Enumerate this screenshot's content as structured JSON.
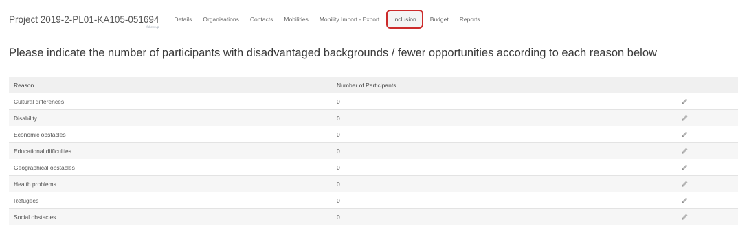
{
  "project": {
    "title": "Project 2019-2-PL01-KA105-051694",
    "subtitle": "follow-up"
  },
  "nav": {
    "tabs": [
      {
        "label": "Details",
        "active": false
      },
      {
        "label": "Organisations",
        "active": false
      },
      {
        "label": "Contacts",
        "active": false
      },
      {
        "label": "Mobilities",
        "active": false
      },
      {
        "label": "Mobility Import - Export",
        "active": false
      },
      {
        "label": "Inclusion",
        "active": true
      },
      {
        "label": "Budget",
        "active": false
      },
      {
        "label": "Reports",
        "active": false
      }
    ]
  },
  "heading": "Please indicate the number of participants with disadvantaged backgrounds / fewer opportunities according to each reason below",
  "table": {
    "columns": [
      "Reason",
      "Number of Participants"
    ],
    "rows": [
      {
        "reason": "Cultural differences",
        "count": "0"
      },
      {
        "reason": "Disability",
        "count": "0"
      },
      {
        "reason": "Economic obstacles",
        "count": "0"
      },
      {
        "reason": "Educational difficulties",
        "count": "0"
      },
      {
        "reason": "Geographical obstacles",
        "count": "0"
      },
      {
        "reason": "Health problems",
        "count": "0"
      },
      {
        "reason": "Refugees",
        "count": "0"
      },
      {
        "reason": "Social obstacles",
        "count": "0"
      }
    ],
    "edit_icon": "pencil-icon"
  },
  "colors": {
    "active_tab_border": "#cc2b2b",
    "header_bg": "#f0f0f0",
    "row_alt_bg": "#f6f6f6",
    "text": "#555555"
  }
}
